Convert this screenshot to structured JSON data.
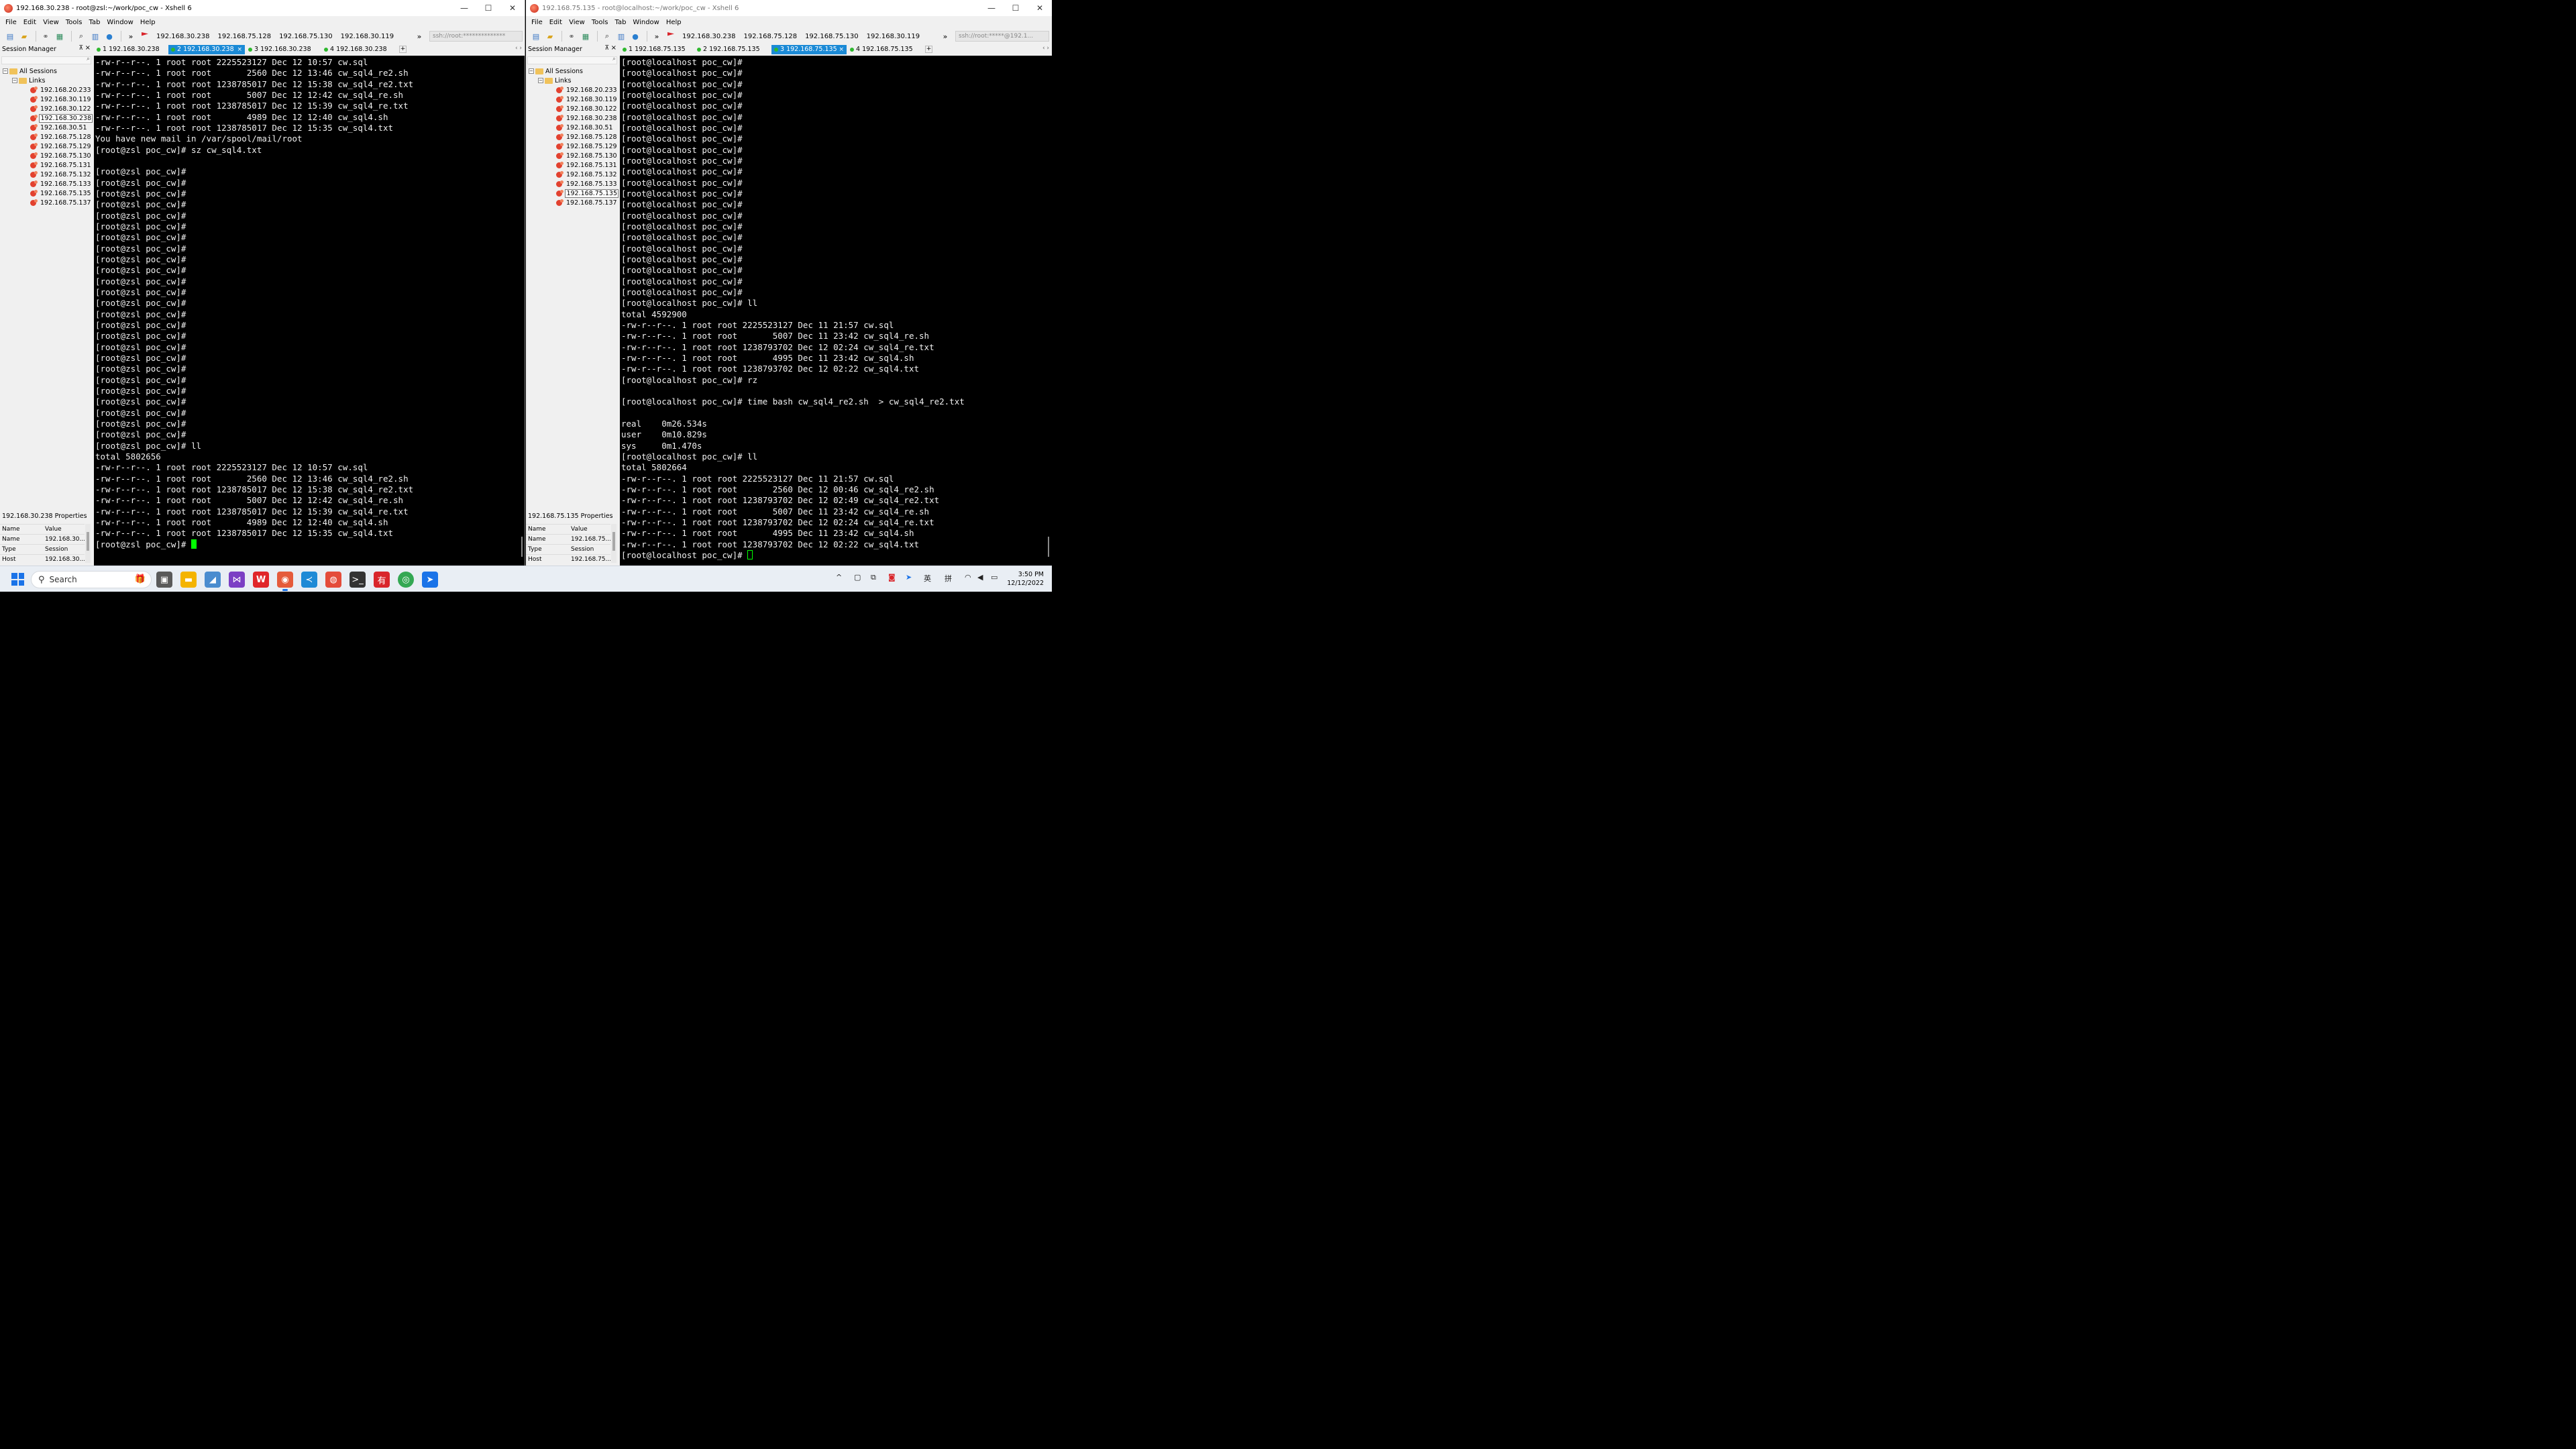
{
  "left": {
    "title": "192.168.30.238 - root@zsl:~/work/poc_cw - Xshell 6",
    "addr": "ssh://root:**************",
    "active_host": "192.168.30.238",
    "tabs": [
      {
        "label": "1 192.168.30.238",
        "active": false
      },
      {
        "label": "2 192.168.30.238",
        "active": true
      },
      {
        "label": "3 192.168.30.238",
        "active": false
      },
      {
        "label": "4 192.168.30.238",
        "active": false
      }
    ],
    "props_title": "192.168.30.238 Properties",
    "props": [
      {
        "k": "Name",
        "v": "192.168.30..."
      },
      {
        "k": "Type",
        "v": "Session"
      },
      {
        "k": "Host",
        "v": "192.168.30..."
      }
    ],
    "terminal": [
      "-rw-r--r--. 1 root root 2225523127 Dec 12 10:57 cw.sql",
      "-rw-r--r--. 1 root root       2560 Dec 12 13:46 cw_sql4_re2.sh",
      "-rw-r--r--. 1 root root 1238785017 Dec 12 15:38 cw_sql4_re2.txt",
      "-rw-r--r--. 1 root root       5007 Dec 12 12:42 cw_sql4_re.sh",
      "-rw-r--r--. 1 root root 1238785017 Dec 12 15:39 cw_sql4_re.txt",
      "-rw-r--r--. 1 root root       4989 Dec 12 12:40 cw_sql4.sh",
      "-rw-r--r--. 1 root root 1238785017 Dec 12 15:35 cw_sql4.txt",
      "You have new mail in /var/spool/mail/root",
      "[root@zsl poc_cw]# sz cw_sql4.txt",
      "",
      "[root@zsl poc_cw]#",
      "[root@zsl poc_cw]#",
      "[root@zsl poc_cw]#",
      "[root@zsl poc_cw]#",
      "[root@zsl poc_cw]#",
      "[root@zsl poc_cw]#",
      "[root@zsl poc_cw]#",
      "[root@zsl poc_cw]#",
      "[root@zsl poc_cw]#",
      "[root@zsl poc_cw]#",
      "[root@zsl poc_cw]#",
      "[root@zsl poc_cw]#",
      "[root@zsl poc_cw]#",
      "[root@zsl poc_cw]#",
      "[root@zsl poc_cw]#",
      "[root@zsl poc_cw]#",
      "[root@zsl poc_cw]#",
      "[root@zsl poc_cw]#",
      "[root@zsl poc_cw]#",
      "[root@zsl poc_cw]#",
      "[root@zsl poc_cw]#",
      "[root@zsl poc_cw]#",
      "[root@zsl poc_cw]#",
      "[root@zsl poc_cw]#",
      "[root@zsl poc_cw]#",
      "[root@zsl poc_cw]# ll",
      "total 5802656",
      "-rw-r--r--. 1 root root 2225523127 Dec 12 10:57 cw.sql",
      "-rw-r--r--. 1 root root       2560 Dec 12 13:46 cw_sql4_re2.sh",
      "-rw-r--r--. 1 root root 1238785017 Dec 12 15:38 cw_sql4_re2.txt",
      "-rw-r--r--. 1 root root       5007 Dec 12 12:42 cw_sql4_re.sh",
      "-rw-r--r--. 1 root root 1238785017 Dec 12 15:39 cw_sql4_re.txt",
      "-rw-r--r--. 1 root root       4989 Dec 12 12:40 cw_sql4.sh",
      "-rw-r--r--. 1 root root 1238785017 Dec 12 15:35 cw_sql4.txt",
      "[root@zsl poc_cw]# "
    ]
  },
  "right": {
    "title": "192.168.75.135 - root@localhost:~/work/poc_cw - Xshell 6",
    "addr": "ssh://root:*****@192.1...",
    "active_host": "192.168.75.135",
    "tabs": [
      {
        "label": "1 192.168.75.135",
        "active": false
      },
      {
        "label": "2 192.168.75.135",
        "active": false
      },
      {
        "label": "3 192.168.75.135",
        "active": true
      },
      {
        "label": "4 192.168.75.135",
        "active": false
      }
    ],
    "props_title": "192.168.75.135 Properties",
    "props": [
      {
        "k": "Name",
        "v": "192.168.75..."
      },
      {
        "k": "Type",
        "v": "Session"
      },
      {
        "k": "Host",
        "v": "192.168.75..."
      }
    ],
    "terminal": [
      "[root@localhost poc_cw]#",
      "[root@localhost poc_cw]#",
      "[root@localhost poc_cw]#",
      "[root@localhost poc_cw]#",
      "[root@localhost poc_cw]#",
      "[root@localhost poc_cw]#",
      "[root@localhost poc_cw]#",
      "[root@localhost poc_cw]#",
      "[root@localhost poc_cw]#",
      "[root@localhost poc_cw]#",
      "[root@localhost poc_cw]#",
      "[root@localhost poc_cw]#",
      "[root@localhost poc_cw]#",
      "[root@localhost poc_cw]#",
      "[root@localhost poc_cw]#",
      "[root@localhost poc_cw]#",
      "[root@localhost poc_cw]#",
      "[root@localhost poc_cw]#",
      "[root@localhost poc_cw]#",
      "[root@localhost poc_cw]#",
      "[root@localhost poc_cw]#",
      "[root@localhost poc_cw]#",
      "[root@localhost poc_cw]# ll",
      "total 4592900",
      "-rw-r--r--. 1 root root 2225523127 Dec 11 21:57 cw.sql",
      "-rw-r--r--. 1 root root       5007 Dec 11 23:42 cw_sql4_re.sh",
      "-rw-r--r--. 1 root root 1238793702 Dec 12 02:24 cw_sql4_re.txt",
      "-rw-r--r--. 1 root root       4995 Dec 11 23:42 cw_sql4.sh",
      "-rw-r--r--. 1 root root 1238793702 Dec 12 02:22 cw_sql4.txt",
      "[root@localhost poc_cw]# rz",
      "",
      "[root@localhost poc_cw]# time bash cw_sql4_re2.sh  > cw_sql4_re2.txt",
      "",
      "real    0m26.534s",
      "user    0m10.829s",
      "sys     0m1.470s",
      "[root@localhost poc_cw]# ll",
      "total 5802664",
      "-rw-r--r--. 1 root root 2225523127 Dec 11 21:57 cw.sql",
      "-rw-r--r--. 1 root root       2560 Dec 12 00:46 cw_sql4_re2.sh",
      "-rw-r--r--. 1 root root 1238793702 Dec 12 02:49 cw_sql4_re2.txt",
      "-rw-r--r--. 1 root root       5007 Dec 11 23:42 cw_sql4_re.sh",
      "-rw-r--r--. 1 root root 1238793702 Dec 12 02:24 cw_sql4_re.txt",
      "-rw-r--r--. 1 root root       4995 Dec 11 23:42 cw_sql4.sh",
      "-rw-r--r--. 1 root root 1238793702 Dec 12 02:22 cw_sql4.txt",
      "[root@localhost poc_cw]# "
    ]
  },
  "common": {
    "menu": [
      "File",
      "Edit",
      "View",
      "Tools",
      "Tab",
      "Window",
      "Help"
    ],
    "quick_links": [
      "192.168.30.238",
      "192.168.75.128",
      "192.168.75.130",
      "192.168.30.119"
    ],
    "session_manager_label": "Session Manager",
    "tree_root": "All Sessions",
    "tree_folder": "Links",
    "sessions": [
      "192.168.20.233",
      "192.168.30.119",
      "192.168.30.122",
      "192.168.30.238",
      "192.168.30.51",
      "192.168.75.128",
      "192.168.75.129",
      "192.168.75.130",
      "192.168.75.131",
      "192.168.75.132",
      "192.168.75.133",
      "192.168.75.135",
      "192.168.75.137"
    ],
    "props_col_name": "Name",
    "props_col_value": "Value",
    "icons": {
      "minimize": "minimize-icon",
      "maximize": "maximize-icon",
      "close": "close-icon",
      "app": "xshell-icon"
    }
  },
  "taskbar": {
    "search_label": "Search",
    "tray_ime_1": "英",
    "tray_ime_2": "拼",
    "time": "3:50 PM",
    "date": "12/12/2022",
    "accent": "#1a73e8"
  }
}
